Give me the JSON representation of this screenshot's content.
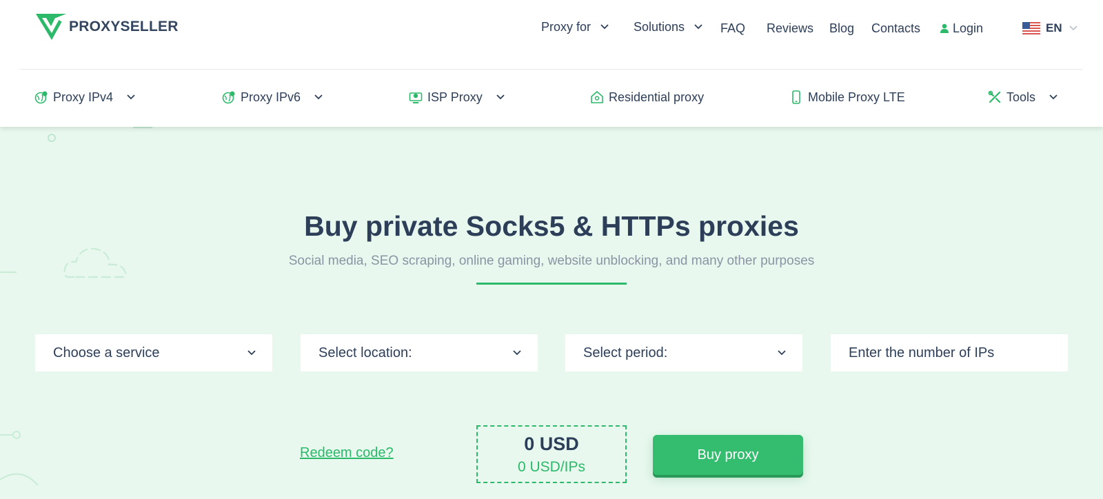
{
  "brand": {
    "name": "PROXYSELLER",
    "color": "#2cb96a",
    "text_color": "#34465f"
  },
  "topnav": {
    "proxy_for": "Proxy for",
    "solutions": "Solutions",
    "faq": "FAQ",
    "reviews": "Reviews",
    "blog": "Blog",
    "contacts": "Contacts",
    "login": "Login",
    "language": "EN"
  },
  "subnav": [
    {
      "label": "Proxy IPv4",
      "icon": "globe-pin-icon"
    },
    {
      "label": "Proxy IPv6",
      "icon": "globe-pin-icon"
    },
    {
      "label": "ISP Proxy",
      "icon": "monitor-pin-icon"
    },
    {
      "label": "Residential proxy",
      "icon": "home-icon"
    },
    {
      "label": "Mobile Proxy LTE",
      "icon": "mobile-icon"
    },
    {
      "label": "Tools",
      "icon": "tools-icon"
    }
  ],
  "hero": {
    "title": "Buy private Socks5 & HTTPs proxies",
    "subtitle": "Social media, SEO scraping, online gaming, website unblocking, and many other purposes"
  },
  "form": {
    "service": "Choose a service",
    "location": "Select location:",
    "period": "Select period:",
    "ips_placeholder": "Enter the number of IPs"
  },
  "checkout": {
    "redeem": "Redeem code?",
    "total": "0 USD",
    "per_ip": "0 USD/IPs",
    "buy": "Buy proxy"
  }
}
